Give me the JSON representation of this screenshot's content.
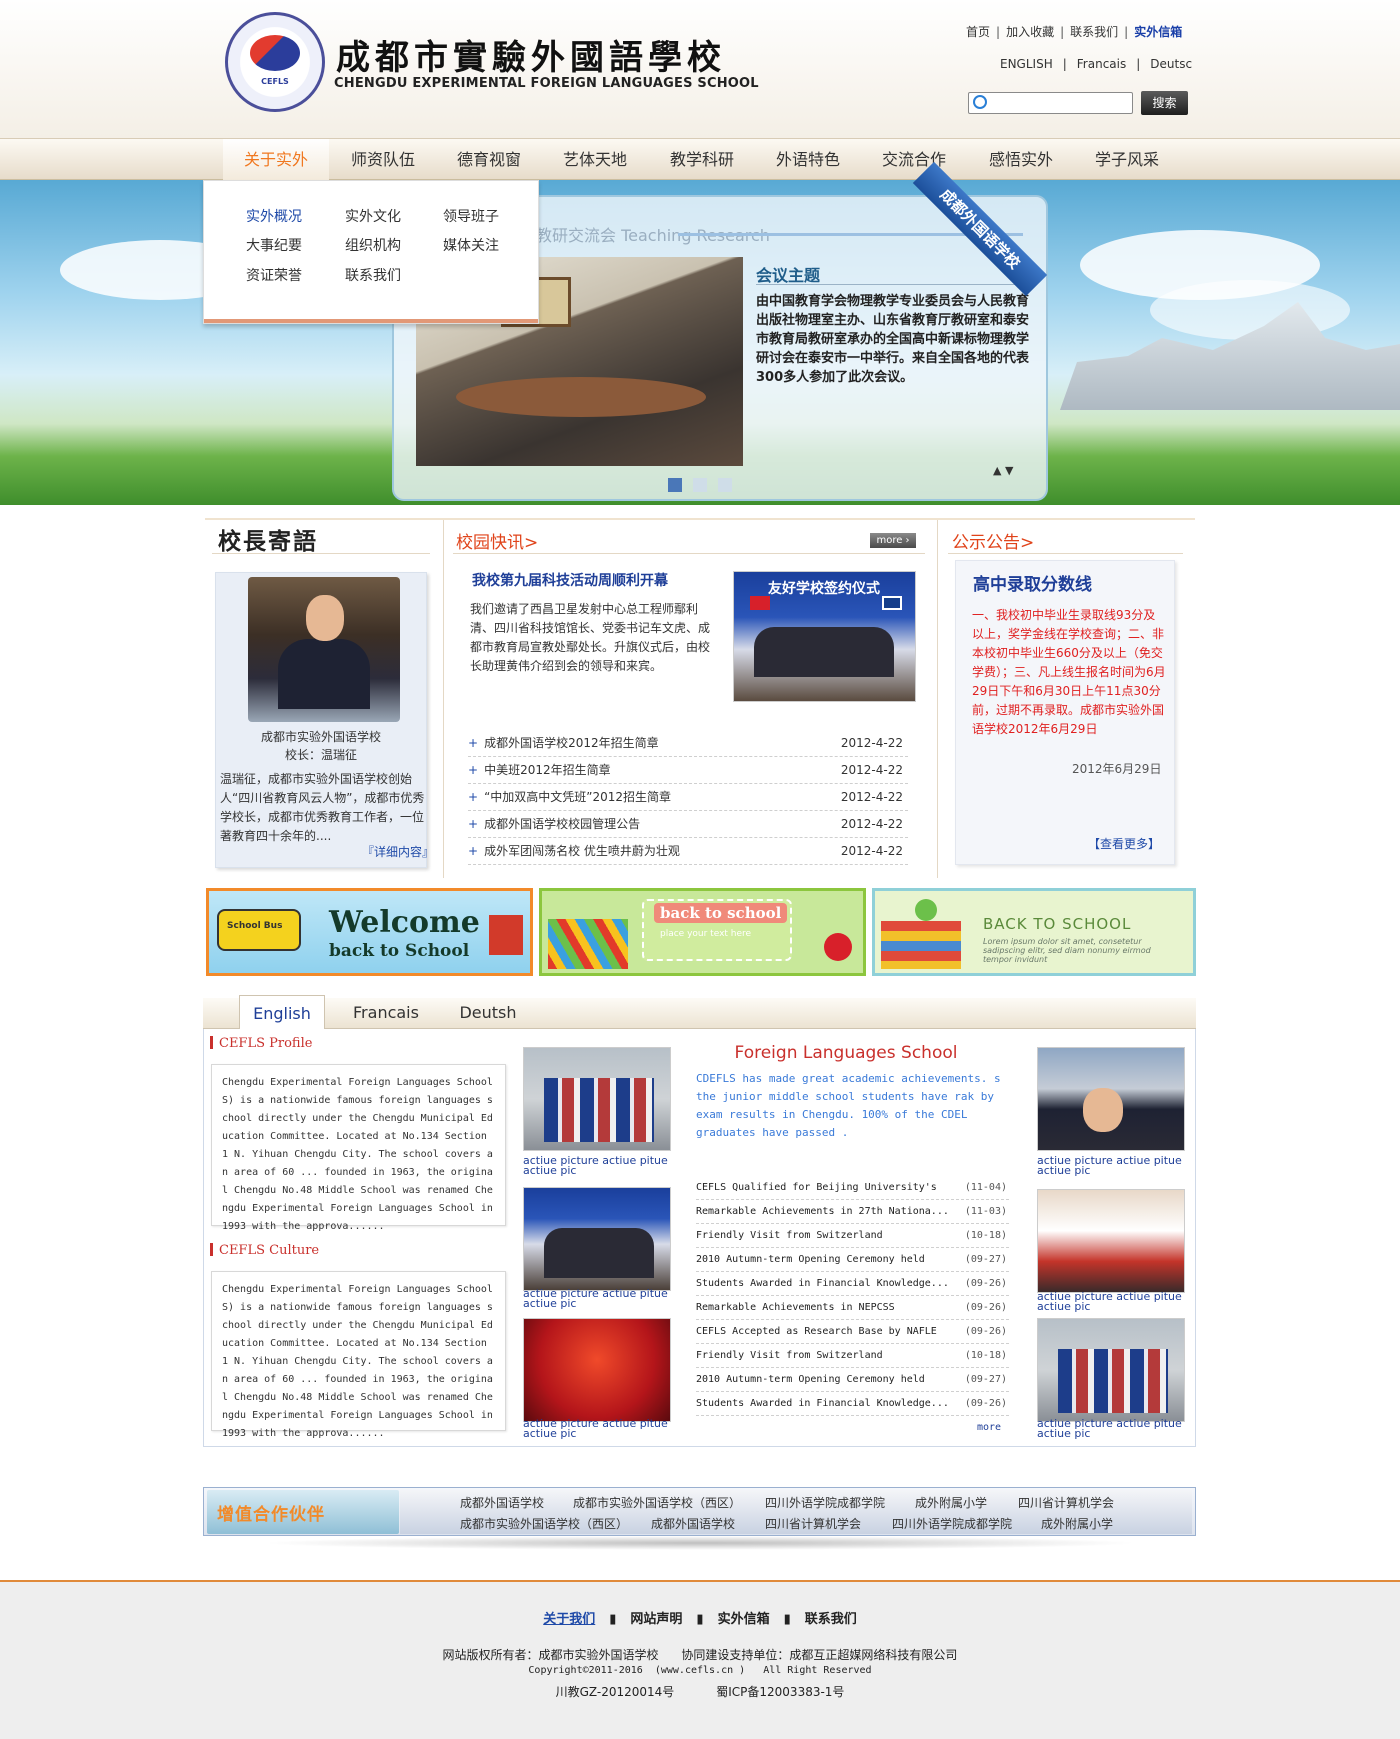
{
  "header": {
    "logo_cn": "成都市實驗外國語學校",
    "logo_en": "CHENGDU EXPERIMENTAL FOREIGN LANGUAGES SCHOOL",
    "emblem_text": "CEFLS",
    "top_links": [
      "首页",
      "加入收藏",
      "联系我们",
      "实外信箱"
    ],
    "top_sep": "|",
    "lang_links": [
      "ENGLISH",
      "Francais",
      "Deutsc"
    ],
    "search_placeholder": "",
    "search_button": "搜索"
  },
  "nav": {
    "items": [
      "关于实外",
      "师资队伍",
      "德育视窗",
      "艺体天地",
      "教学科研",
      "外语特色",
      "交流合作",
      "感悟实外",
      "学子风采"
    ],
    "active_index": 0
  },
  "dropdown": {
    "items": [
      "实外概况",
      "实外文化",
      "领导班子",
      "大事纪要",
      "组织机构",
      "媒体关注",
      "资证荣誉",
      "联系我们"
    ]
  },
  "banner": {
    "watermark": "教研交流会 Teaching Research",
    "ribbon": "成都外国语学校",
    "title": "会议主题",
    "body": "由中国教育学会物理教学专业委员会与人民教育出版社物理室主办、山东省教育厅教研室和泰安市教育局教研室承办的全国高中新课标物理教学研讨会在泰安市一中举行。来自全国各地的代表300多人参加了此次会议。",
    "slides": 3,
    "active_slide": 0,
    "arrows": "▲  ▼"
  },
  "principal": {
    "title": "校長寄語",
    "caption1": "成都市实验外国语学校",
    "caption2": "校长：温瑞征",
    "desc": "温瑞征，成都市实验外国语学校创始人“四川省教育风云人物”，成都市优秀学校长，成都市优秀教育工作者，一位著教育四十余年的....",
    "more": "『详细内容』"
  },
  "news": {
    "head": "校园快讯>",
    "more": "more ›",
    "feature_title": "我校第九届科技活动周顺利开幕",
    "feature_body": "我们邀请了西昌卫星发射中心总工程师鄢利清、四川省科技馆馆长、党委书记车文虎、成都市教育局宣教处鄢处长。升旗仪式后，由校长助理黄伟介绍到会的领导和来宾。",
    "feature_img_text": "友好学校签约仪式",
    "list": [
      {
        "title": "成都外国语学校2012年招生简章",
        "date": "2012-4-22"
      },
      {
        "title": "中美班2012年招生简章",
        "date": "2012-4-22"
      },
      {
        "title": "“中加双高中文凭班”2012招生简章",
        "date": "2012-4-22"
      },
      {
        "title": "成都外国语学校校园管理公告",
        "date": "2012-4-22"
      },
      {
        "title": "成外军团闯荡名校  优生喷井蔚为壮观",
        "date": "2012-4-22"
      }
    ]
  },
  "notice": {
    "head": "公示公告>",
    "title": "高中录取分数线",
    "body": "一、我校初中毕业生录取线93分及以上，奖学金线在学校查询；二、非本校初中毕业生660分及以上（免交学费）；三、凡上线生报名时间为6月29日下午和6月30日上午11点30分前，过期不再录取。成都市实验外国语学校2012年6月29日",
    "date": "2012年6月29日",
    "more": "【查看更多】"
  },
  "promos": {
    "p1_title": "Welcome",
    "p1_sub": "back to School",
    "p1_bus": "School Bus",
    "p2_title": "back to school",
    "p2_sub": "place your text here",
    "p3_title": "BACK TO SCHOOL",
    "p3_sub": "Lorem ipsum dolor sit amet, consetetur sadipscing elitr, sed diam nonumy eirmod tempor invidunt"
  },
  "tabs": {
    "items": [
      "English",
      "Francais",
      "Deutsh"
    ],
    "active_index": 0
  },
  "english": {
    "profile_head": "CEFLS  Profile",
    "profile_text": "Chengdu Experimental Foreign Languages School S) is a nationwide famous foreign languages school directly under the Chengdu Municipal Education Committee. Located at No.134 Section 1 N. Yihuan Chengdu City. The school covers an area of 60 ... founded in 1963, the original Chengdu No.48 Middle School was renamed Chengdu Experimental Foreign Languages School in 1993 with the approva......",
    "culture_head": "CEFLS  Culture",
    "culture_text": "Chengdu Experimental Foreign Languages School S) is a nationwide famous foreign languages school directly under the Chengdu Municipal Education Committee. Located at No.134 Section 1 N. Yihuan Chengdu City. The school covers an area of 60 ... founded in 1963, the original Chengdu No.48 Middle School was renamed Chengdu Experimental Foreign Languages School in 1993 with the approva......",
    "thumb_caption": "actiue picture actiue pitue actiue pic",
    "fls_title": "Foreign Languages School",
    "fls_body": "CDEFLS has made great academic achievements. s the junior middle school students have rak by exam results in Chengdu. 100% of the CDEL graduates have passed .",
    "news": [
      {
        "t": "CEFLS Qualified for Beijing University's",
        "d": "(11-04)"
      },
      {
        "t": "Remarkable Achievements in 27th Nationa...",
        "d": "(11-03)"
      },
      {
        "t": "Friendly Visit from Switzerland",
        "d": "(10-18)"
      },
      {
        "t": "2010 Autumn-term Opening Ceremony held",
        "d": "(09-27)"
      },
      {
        "t": "Students Awarded in Financial Knowledge...",
        "d": "(09-26)"
      },
      {
        "t": "Remarkable Achievements in NEPCSS",
        "d": "(09-26)"
      },
      {
        "t": "CEFLS Accepted as Research Base by NAFLE",
        "d": "(09-26)"
      },
      {
        "t": "Friendly Visit from Switzerland",
        "d": "(10-18)"
      },
      {
        "t": "2010 Autumn-term Opening Ceremony held",
        "d": "(09-27)"
      },
      {
        "t": "Students Awarded in Financial Knowledge...",
        "d": "(09-26)"
      }
    ],
    "more": "more"
  },
  "partners": {
    "label": "增值合作伙伴",
    "row1": [
      "成都外国语学校",
      "成都市实验外国语学校（西区）",
      "四川外语学院成都学院",
      "成外附属小学",
      "四川省计算机学会"
    ],
    "row2": [
      "成都市实验外国语学校（西区）",
      "成都外国语学校",
      "四川省计算机学会",
      "四川外语学院成都学院",
      "成外附属小学"
    ]
  },
  "footer": {
    "links": [
      "关于我们",
      "网站声明",
      "实外信箱",
      "联系我们"
    ],
    "line1": "网站版权所有者：成都市实验外国语学校      协同建设支持单位：成都互正超媒网络科技有限公司",
    "line2": "Copyright©2011-2016  (www.cefls.cn )   All Right Reserved",
    "line3": "川教GZ-20120014号           蜀ICP备12003383-1号"
  },
  "colors": {
    "accent_orange": "#f07820",
    "link_blue": "#1f3f98",
    "notice_red": "#e02020",
    "heading_red": "#c9302c"
  }
}
